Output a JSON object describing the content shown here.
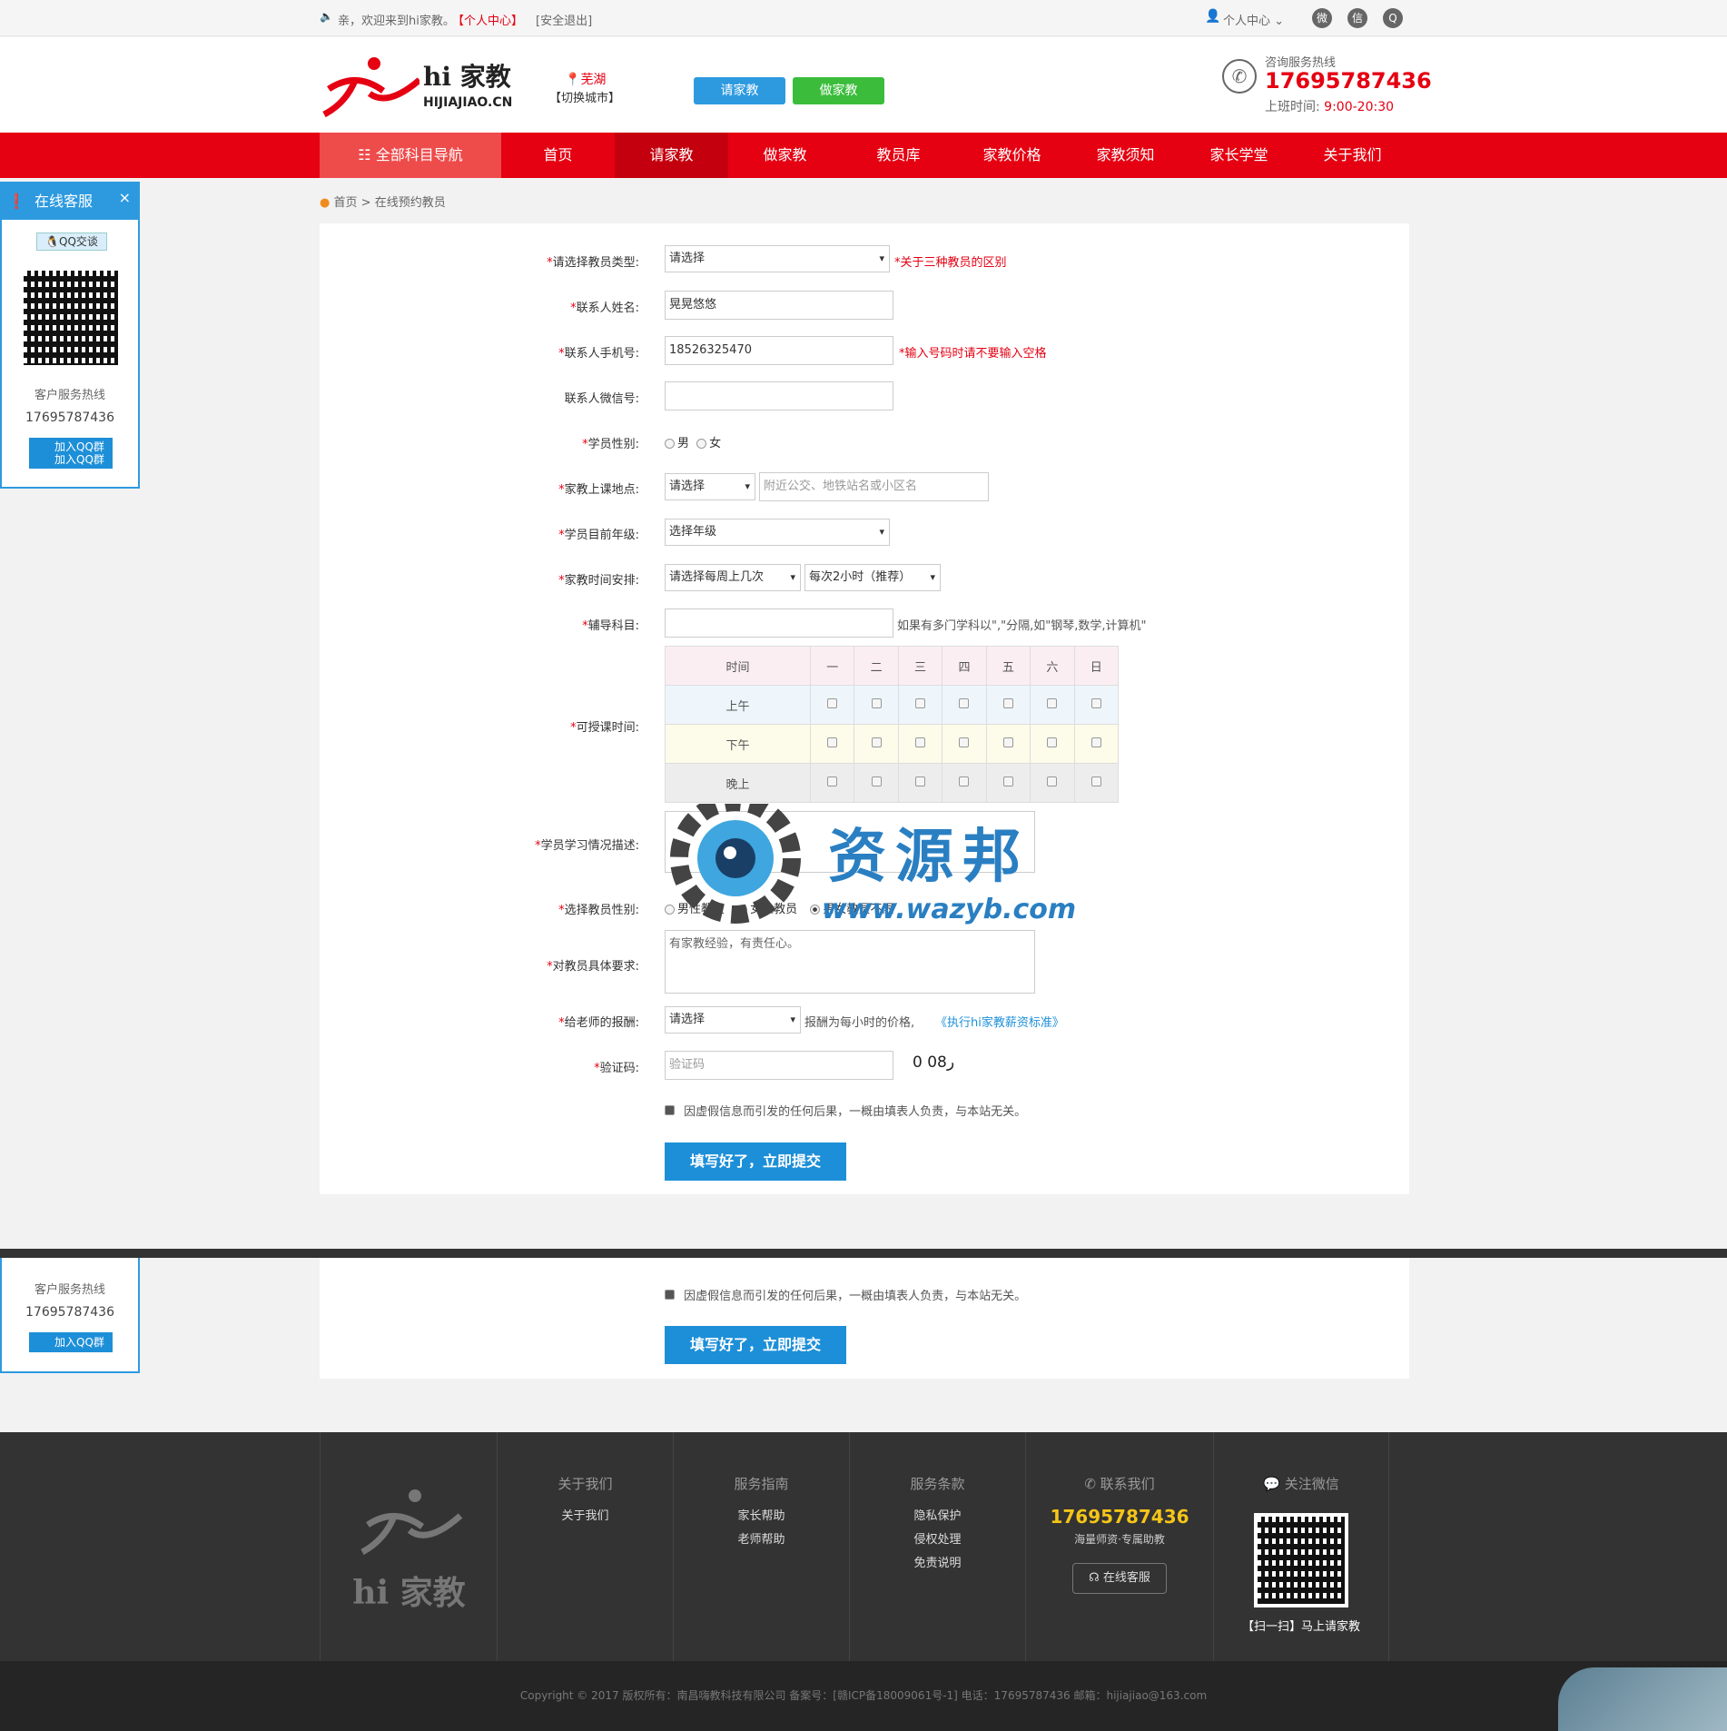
{
  "topbar": {
    "welcome": "亲，欢迎来到hi家教。",
    "personal_center_link": "【个人中心】",
    "logout_link": "[安全退出]",
    "user_menu": "个人中心"
  },
  "header": {
    "logo_cn": "hi 家教",
    "logo_en": "HIJIAJIAO.CN",
    "city": "芜湖",
    "switch_city": "【切换城市】",
    "btn_hire": "请家教",
    "btn_tutor": "做家教",
    "hotline_label": "咨询服务热线",
    "hotline": "17695787436",
    "hours_label": "上班时间:",
    "hours": "9:00-20:30"
  },
  "nav": {
    "all_subjects": "全部科目导航",
    "items": [
      "首页",
      "请家教",
      "做家教",
      "教员库",
      "家教价格",
      "家教须知",
      "家长学堂",
      "关于我们"
    ]
  },
  "side": {
    "title": "在线客服",
    "qq_chat": "QQ交谈",
    "hotline_label": "客户服务热线",
    "hotline": "17695787436",
    "join_qq": "加入QQ群",
    "join_qq2": "加入QQ群"
  },
  "breadcrumb": {
    "home": "首页",
    "sep": ">",
    "current": "在线预约教员"
  },
  "form": {
    "teacher_type": {
      "label": "请选择教员类型:",
      "value": "请选择",
      "hint": "*关于三种教员的区别"
    },
    "contact_name": {
      "label": "联系人姓名:",
      "value": "晃晃悠悠"
    },
    "contact_phone": {
      "label": "联系人手机号:",
      "value": "18526325470",
      "hint": "*输入号码时请不要输入空格"
    },
    "contact_wechat": {
      "label": "联系人微信号:",
      "value": ""
    },
    "student_gender": {
      "label": "学员性别:",
      "options": [
        "男",
        "女"
      ]
    },
    "location": {
      "label": "家教上课地点:",
      "select": "请选择",
      "placeholder": "附近公交、地铁站名或小区名"
    },
    "grade": {
      "label": "学员目前年级:",
      "value": "选择年级"
    },
    "schedule": {
      "label": "家教时间安排:",
      "times_per_week": "请选择每周上几次",
      "hours": "每次2小时（推荐）"
    },
    "subject": {
      "label": "辅导科目:",
      "value": "",
      "hint": "如果有多门学科以\",\"分隔,如\"钢琴,数学,计算机\""
    },
    "available_time": {
      "label": "可授课时间:",
      "header": [
        "时间",
        "一",
        "二",
        "三",
        "四",
        "五",
        "六",
        "日"
      ],
      "rows": [
        "上午",
        "下午",
        "晚上"
      ]
    },
    "study_desc": {
      "label": "学员学习情况描述:",
      "value": ""
    },
    "teacher_gender": {
      "label": "选择教员性别:",
      "options": [
        "男性教员",
        "女性教员",
        "男女教员不限"
      ]
    },
    "requirements": {
      "label": "对教员具体要求:",
      "value": "有家教经验，有责任心。"
    },
    "pay": {
      "label": "给老师的报酬:",
      "value": "请选择",
      "hint": "报酬为每小时的价格,",
      "link": "《执行hi家教薪资标准》"
    },
    "captcha": {
      "label": "验证码:",
      "placeholder": "验证码",
      "code": "ر08 0"
    },
    "agree": "因虚假信息而引发的任何后果，一概由填表人负责，与本站无关。",
    "submit": "填写好了，立即提交"
  },
  "watermark": {
    "cn": "资源邦",
    "url": "www.wazyb.com"
  },
  "footer": {
    "logo": "hi 家教",
    "about": {
      "title": "关于我们",
      "links": [
        "关于我们"
      ]
    },
    "guide": {
      "title": "服务指南",
      "links": [
        "家长帮助",
        "老师帮助"
      ]
    },
    "terms": {
      "title": "服务条款",
      "links": [
        "隐私保护",
        "侵权处理",
        "免责说明"
      ]
    },
    "contact": {
      "title": "联系我们",
      "phone": "17695787436",
      "slogan": "海量师资·专属助教",
      "online": "在线客服"
    },
    "wechat": {
      "title": "关注微信",
      "scan": "【扫一扫】马上请家教"
    },
    "copyright": "Copyright © 2017 版权所有：南昌嗨教科技有限公司    备案号：[赣ICP备18009061号-1]    电话：17695787436    邮箱：hijiajiao@163.com"
  },
  "colors": {
    "brand_red": "#e50012",
    "brand_blue": "#2d9ae0",
    "green": "#3bbd3b"
  }
}
